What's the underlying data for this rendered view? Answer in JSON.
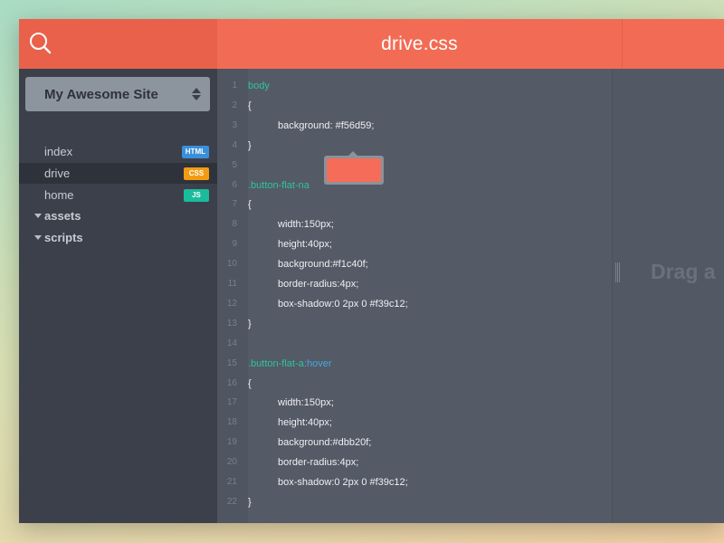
{
  "header": {
    "file_title": "drive.css",
    "search_icon": "search-icon"
  },
  "sidebar": {
    "site_select": {
      "label": "My Awesome Site",
      "icon": "sort-arrows-icon"
    },
    "files": [
      {
        "label": "index",
        "badge": "HTML",
        "badge_color": "#3a8fd9",
        "active": false
      },
      {
        "label": "drive",
        "badge": "CSS",
        "badge_color": "#f39c12",
        "active": true
      },
      {
        "label": "home",
        "badge": "JS",
        "badge_color": "#1abc9c",
        "active": false
      }
    ],
    "folders": [
      {
        "label": "assets",
        "icon": "caret-down-icon"
      },
      {
        "label": "scripts",
        "icon": "caret-down-icon"
      }
    ]
  },
  "editor": {
    "lines": [
      {
        "n": "1",
        "text": "body",
        "kind": "sel",
        "indent": false
      },
      {
        "n": "2",
        "text": "{",
        "kind": "plain",
        "indent": false
      },
      {
        "n": "3",
        "text": "background: #f56d59;",
        "kind": "plain",
        "indent": true
      },
      {
        "n": "4",
        "text": "}",
        "kind": "plain",
        "indent": false
      },
      {
        "n": "5",
        "text": "",
        "kind": "plain",
        "indent": false
      },
      {
        "n": "6",
        "text": ".button-flat-na",
        "kind": "sel",
        "indent": false
      },
      {
        "n": "7",
        "text": "{",
        "kind": "plain",
        "indent": false
      },
      {
        "n": "8",
        "text": "width:150px;",
        "kind": "plain",
        "indent": true
      },
      {
        "n": "9",
        "text": "height:40px;",
        "kind": "plain",
        "indent": true
      },
      {
        "n": "10",
        "text": "background:#f1c40f;",
        "kind": "plain",
        "indent": true
      },
      {
        "n": "11",
        "text": "border-radius:4px;",
        "kind": "plain",
        "indent": true
      },
      {
        "n": "12",
        "text": "box-shadow:0 2px 0 #f39c12;",
        "kind": "plain",
        "indent": true
      },
      {
        "n": "13",
        "text": "}",
        "kind": "plain",
        "indent": false
      },
      {
        "n": "14",
        "text": "",
        "kind": "plain",
        "indent": false
      },
      {
        "n": "15",
        "text": ".button-flat-a",
        "kind": "sel",
        "indent": false,
        "pseudo": ":hover"
      },
      {
        "n": "16",
        "text": "{",
        "kind": "plain",
        "indent": false
      },
      {
        "n": "17",
        "text": "width:150px;",
        "kind": "plain",
        "indent": true
      },
      {
        "n": "18",
        "text": "height:40px;",
        "kind": "plain",
        "indent": true
      },
      {
        "n": "19",
        "text": "background:#dbb20f;",
        "kind": "plain",
        "indent": true
      },
      {
        "n": "20",
        "text": "border-radius:4px;",
        "kind": "plain",
        "indent": true
      },
      {
        "n": "21",
        "text": "box-shadow:0 2px 0 #f39c12;",
        "kind": "plain",
        "indent": true
      },
      {
        "n": "22",
        "text": "}",
        "kind": "plain",
        "indent": false
      }
    ],
    "color_preview": {
      "color": "#f56d59"
    }
  },
  "preview": {
    "drag_text": "Drag a",
    "handle_icon": "drag-handle-icon"
  },
  "colors": {
    "accent": "#f26c55",
    "accent_dark": "#e9614a",
    "sidebar_bg": "#3c404b",
    "editor_bg": "#545a66",
    "selector": "#2ec4a0",
    "pseudo": "#46a8df"
  }
}
